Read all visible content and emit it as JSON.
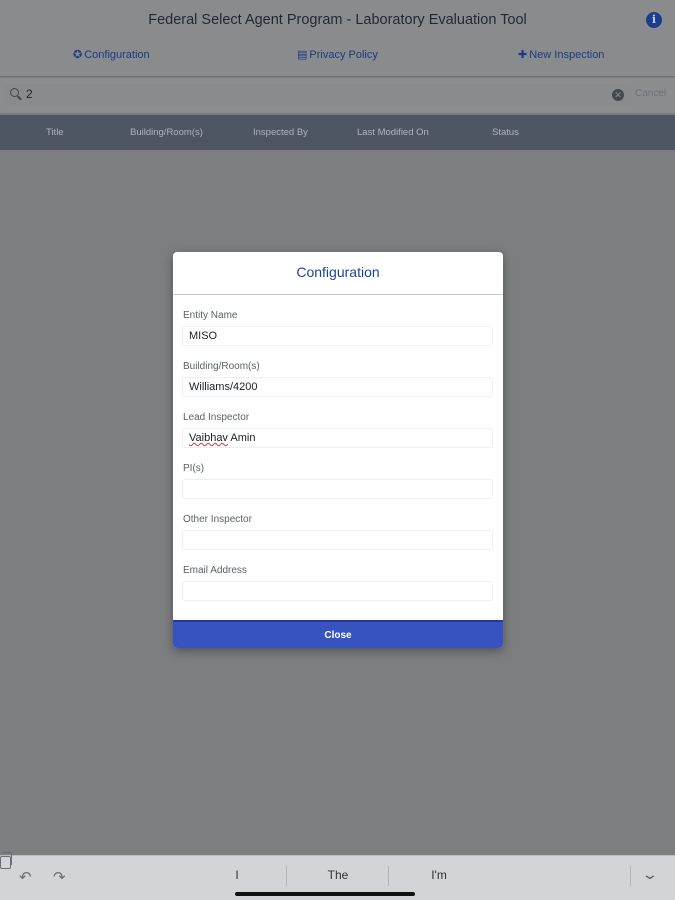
{
  "app": {
    "title": "Federal Select Agent Program - Laboratory Evaluation Tool",
    "info_glyph": "i"
  },
  "nav": {
    "configuration": {
      "icon": "gear-icon",
      "label": "Configuration"
    },
    "privacy": {
      "icon": "document-icon",
      "label": "Privacy Policy"
    },
    "new_inspection": {
      "icon": "plus-icon",
      "label": "New Inspection"
    }
  },
  "search": {
    "value": "2",
    "cancel_label": "Cancel"
  },
  "table": {
    "columns": [
      "Title",
      "Building/Room(s)",
      "Inspected By",
      "Last Modified On",
      "Status"
    ]
  },
  "modal": {
    "title": "Configuration",
    "fields": [
      {
        "label": "Entity Name",
        "value": "MISO"
      },
      {
        "label": "Building/Room(s)",
        "value": "Williams/4200"
      },
      {
        "label": "Lead Inspector",
        "value": "Vaibhav Amin"
      },
      {
        "label": "PI(s)",
        "value": ""
      },
      {
        "label": "Other Inspector",
        "value": ""
      },
      {
        "label": "Email Address",
        "value": ""
      }
    ],
    "close_label": "Close"
  },
  "keyboard": {
    "suggestions": [
      "I",
      "The",
      "I'm"
    ]
  },
  "colors": {
    "accent": "#3753c0",
    "title_blue": "#1d4494",
    "table_header": "#4f5663"
  }
}
